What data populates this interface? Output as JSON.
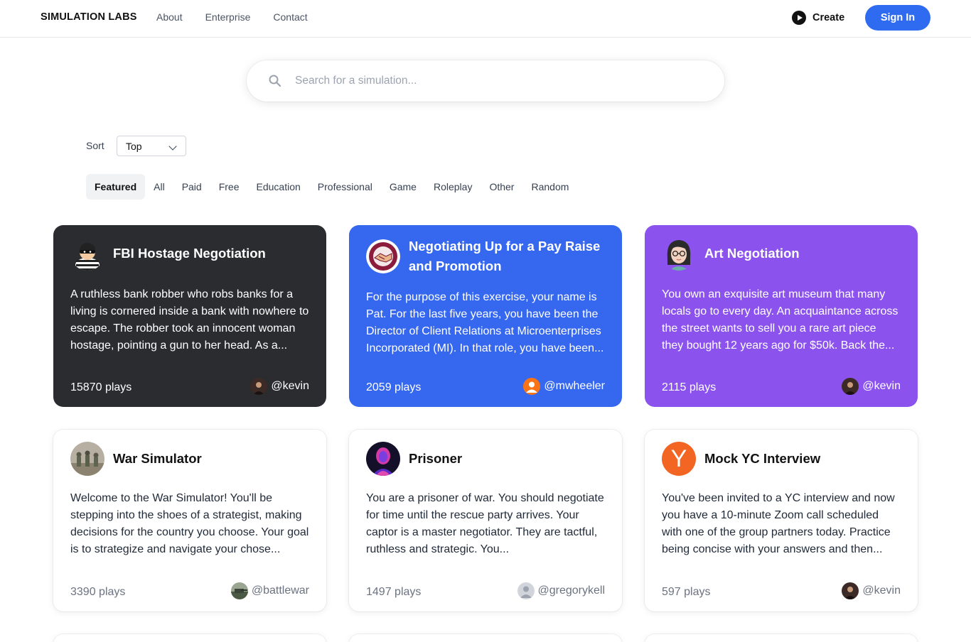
{
  "header": {
    "brand": "SIMULATION LABS",
    "nav": [
      "About",
      "Enterprise",
      "Contact"
    ],
    "create_label": "Create",
    "signin_label": "Sign In",
    "accent_color": "#2f6bf0"
  },
  "search": {
    "placeholder": "Search for a simulation...",
    "icon": "search-icon"
  },
  "sort": {
    "label": "Sort",
    "selected": "Top"
  },
  "tabs": [
    {
      "label": "Featured",
      "active": true
    },
    {
      "label": "All"
    },
    {
      "label": "Paid"
    },
    {
      "label": "Free"
    },
    {
      "label": "Education"
    },
    {
      "label": "Professional"
    },
    {
      "label": "Game"
    },
    {
      "label": "Roleplay"
    },
    {
      "label": "Other"
    },
    {
      "label": "Random"
    }
  ],
  "cards": [
    {
      "title": "FBI Hostage Negotiation",
      "description": "A ruthless bank robber who robs banks for a living is cornered inside a bank with nowhere to escape. The robber took an innocent woman hostage, pointing a gun to her head. As a...",
      "plays": "15870 plays",
      "author": "@kevin",
      "bg_color": "#2a2c30",
      "avatar_icon": "robber-avatar-icon"
    },
    {
      "title": "Negotiating Up for a Pay Raise and Promotion",
      "description": "For the purpose of this exercise, your name is Pat. For the last five years, you have been the Director of Client Relations at Microenterprises Incorporated (MI). In that role, you have been...",
      "plays": "2059 plays",
      "author": "@mwheeler",
      "bg_color": "#3567ef",
      "avatar_icon": "handshake-avatar-icon"
    },
    {
      "title": "Art Negotiation",
      "description": "You own an exquisite art museum that many locals go to every day. An acquaintance across the street wants to sell you a rare art piece they bought 12 years ago for $50k. Back the...",
      "plays": "2115 plays",
      "author": "@kevin",
      "bg_color": "#8b52ee",
      "avatar_icon": "woman-avatar-icon"
    },
    {
      "title": "War Simulator",
      "description": "Welcome to the War Simulator! You'll be stepping into the shoes of a strategist, making decisions for the country you choose. Your goal is to strategize and navigate your chose...",
      "plays": "3390 plays",
      "author": "@battlewar",
      "bg_color": "#ffffff",
      "avatar_icon": "soldiers-avatar-icon"
    },
    {
      "title": "Prisoner",
      "description": "You are a prisoner of war. You should negotiate for time until the rescue party arrives. Your captor is a master negotiator. They are tactful, ruthless and strategic. You...",
      "plays": "1497 plays",
      "author": "@gregorykell",
      "bg_color": "#ffffff",
      "avatar_icon": "neon-figure-avatar-icon"
    },
    {
      "title": "Mock YC Interview",
      "description": "You've been invited to a YC interview and now you have a 10-minute Zoom call scheduled with one of the group partners today. Practice being concise with your answers and then...",
      "plays": "597 plays",
      "author": "@kevin",
      "bg_color": "#ffffff",
      "avatar_icon": "y-logo-avatar-icon",
      "avatar_letter": "Y"
    }
  ]
}
